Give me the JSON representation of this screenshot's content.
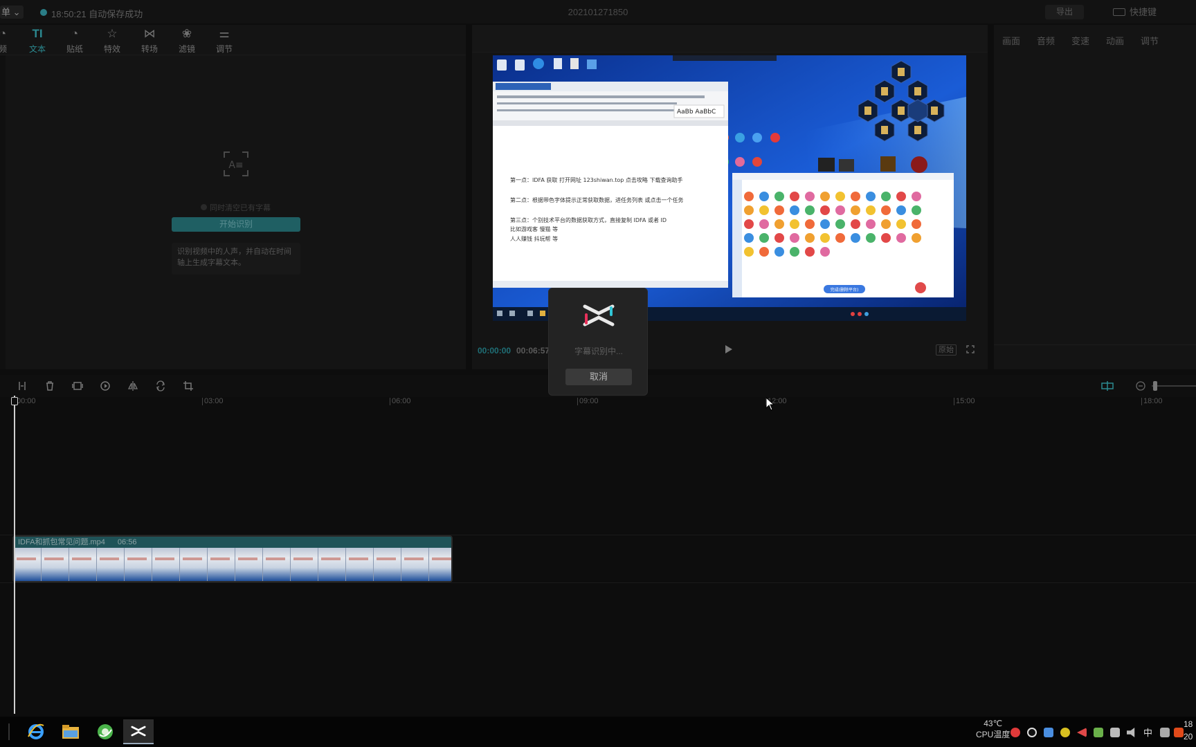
{
  "titlebar": {
    "menu_label": "单",
    "save_status": "18:50:21 自动保存成功",
    "project_name": "202101271850",
    "export_label": "导出",
    "shortcut_label": "快捷键"
  },
  "left_tabs": [
    {
      "label": "频",
      "icon": "audio-icon"
    },
    {
      "label": "文本",
      "icon": "text-icon"
    },
    {
      "label": "贴纸",
      "icon": "sticker-icon"
    },
    {
      "label": "特效",
      "icon": "effects-icon"
    },
    {
      "label": "转场",
      "icon": "transition-icon"
    },
    {
      "label": "滤镜",
      "icon": "filter-icon"
    },
    {
      "label": "调节",
      "icon": "adjust-icon"
    }
  ],
  "caption_panel": {
    "auto_clear_label": "同时清空已有字幕",
    "start_button": "开始识别",
    "description": "识别视频中的人声，并自动在时间轴上生成字幕文本。"
  },
  "player": {
    "current_time": "00:00:00",
    "total_time": "00:06:57",
    "ratio_label": "原始",
    "video_doc_lines": [
      "第一点：IDFA 获取 打开网址 123shiwan.top 点击攻略 下载查询助手",
      "第二点：根据带色字体提示正常获取数据，进任务列表 或点击一个任务",
      "第三点：个别技术平台的数据获取方式，直接复制 IDFA 或者 ID",
      "比如游戏客 慢猫 等",
      "人人赚钱 抖玩帮 等"
    ],
    "video_popup_button": "完成(删除平台)"
  },
  "right_tabs": [
    "画面",
    "音频",
    "变速",
    "动画",
    "调节"
  ],
  "timeline": {
    "ticks": [
      "00:00",
      "03:00",
      "06:00",
      "09:00",
      "12:00",
      "15:00",
      "18:00"
    ],
    "clip_name": "IDFA和抓包常见问题.mp4",
    "clip_duration": "06:56"
  },
  "modal": {
    "status": "字幕识别中...",
    "cancel_label": "取消"
  },
  "taskbar": {
    "apps": [
      "ie-icon",
      "explorer-icon",
      "browser-icon",
      "capcut-icon"
    ],
    "temp": "43℃",
    "temp_label": "CPU温度",
    "ime": "中",
    "clock_top": "18",
    "clock_bottom": "20"
  }
}
